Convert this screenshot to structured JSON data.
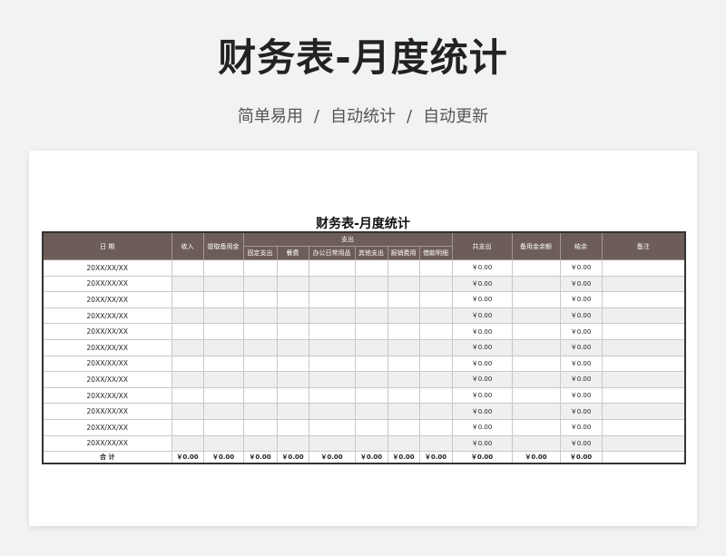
{
  "hero": {
    "title": "财务表-月度统计",
    "subtitle": [
      "简单易用",
      "自动统计",
      "自动更新"
    ],
    "separator": "/"
  },
  "sheet": {
    "title": "财务表-月度统计",
    "columns": {
      "date": "日 期",
      "income": "收入",
      "petty_withdraw": "提取备用金",
      "expense_group": "支出",
      "fixed": "固定支出",
      "meal": "餐费",
      "office": "办公日常用品",
      "other": "其他支出",
      "reimburse": "报销费用",
      "loan": "借款明细",
      "total_expense": "共支出",
      "petty_balance": "备用金余额",
      "balance": "结余",
      "note": "备注"
    },
    "rows": [
      {
        "date": "20XX/XX/XX",
        "total_expense": "￥0.00",
        "balance": "￥0.00"
      },
      {
        "date": "20XX/XX/XX",
        "total_expense": "￥0.00",
        "balance": "￥0.00"
      },
      {
        "date": "20XX/XX/XX",
        "total_expense": "￥0.00",
        "balance": "￥0.00"
      },
      {
        "date": "20XX/XX/XX",
        "total_expense": "￥0.00",
        "balance": "￥0.00"
      },
      {
        "date": "20XX/XX/XX",
        "total_expense": "￥0.00",
        "balance": "￥0.00"
      },
      {
        "date": "20XX/XX/XX",
        "total_expense": "￥0.00",
        "balance": "￥0.00"
      },
      {
        "date": "20XX/XX/XX",
        "total_expense": "￥0.00",
        "balance": "￥0.00"
      },
      {
        "date": "20XX/XX/XX",
        "total_expense": "￥0.00",
        "balance": "￥0.00"
      },
      {
        "date": "20XX/XX/XX",
        "total_expense": "￥0.00",
        "balance": "￥0.00"
      },
      {
        "date": "20XX/XX/XX",
        "total_expense": "￥0.00",
        "balance": "￥0.00"
      },
      {
        "date": "20XX/XX/XX",
        "total_expense": "￥0.00",
        "balance": "￥0.00"
      },
      {
        "date": "20XX/XX/XX",
        "total_expense": "￥0.00",
        "balance": "￥0.00"
      }
    ],
    "total_row": {
      "label": "合 计",
      "income": "￥0.00",
      "petty_withdraw": "￥0.00",
      "fixed": "￥0.00",
      "meal": "￥0.00",
      "office": "￥0.00",
      "other": "￥0.00",
      "reimburse": "￥0.00",
      "loan": "￥0.00",
      "total_expense": "￥0.00",
      "petty_balance": "￥0.00",
      "balance": "￥0.00"
    }
  },
  "colors": {
    "header_bg": "#6d5d58",
    "header_text": "#ffffff",
    "stripe": "#efefef",
    "page_bg": "#f0f2f3"
  }
}
